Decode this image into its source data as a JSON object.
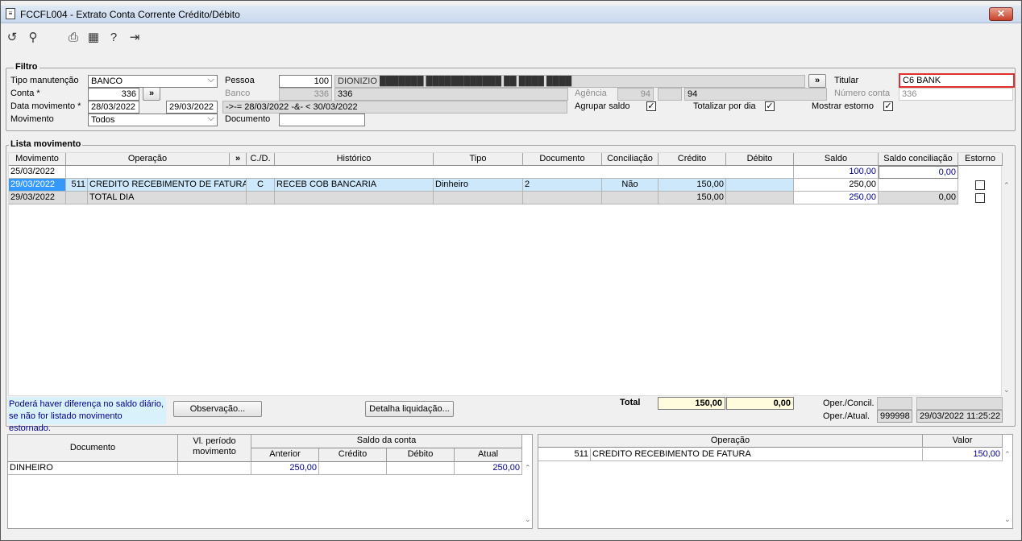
{
  "window": {
    "title": "FCCFL004 - Extrato Conta Corrente Crédito/Débito",
    "close": "✕"
  },
  "toolbar": {
    "icons": [
      "undo-icon",
      "search-icon",
      "print-icon",
      "calendar-icon",
      "help-icon",
      "exit-icon"
    ]
  },
  "filtro": {
    "legend": "Filtro",
    "tipo_manutencao_label": "Tipo manutenção",
    "tipo_manutencao_value": "BANCO",
    "conta_label": "Conta *",
    "conta_value": "336",
    "data_movimento_label": "Data movimento *",
    "data_inicio": "28/03/2022",
    "data_fim": "29/03/2022",
    "data_expr": "->-= 28/03/2022 -&- < 30/03/2022",
    "movimento_label": "Movimento",
    "movimento_value": "Todos",
    "pessoa_label": "Pessoa",
    "pessoa_code": "100",
    "pessoa_name": "DIONIZIO ███████ ████████████ ██ ████ ████",
    "banco_label": "Banco",
    "banco_value": "336",
    "banco_name": "336",
    "agencia_label": "Agência",
    "agencia_value": "94",
    "agencia_name": "94",
    "documento_label": "Documento",
    "documento_value": "",
    "titular_label": "Titular",
    "titular_value": "C6 BANK",
    "numero_conta_label": "Número conta",
    "numero_conta_value": "336",
    "agrupar_saldo_label": "Agrupar saldo",
    "totalizar_label": "Totalizar por dia",
    "mostrar_estorno_label": "Mostrar estorno",
    "more": "»",
    "check": "✓"
  },
  "lista": {
    "legend": "Lista movimento",
    "columns": [
      "Movimento",
      "Operação",
      "»",
      "C./D.",
      "Histórico",
      "Tipo",
      "Documento",
      "Conciliação",
      "Crédito",
      "Débito",
      "Saldo",
      "Saldo conciliação",
      "Estorno"
    ],
    "row0": {
      "movimento": "25/03/2022",
      "saldo": "100,00",
      "saldo_conc": "0,00"
    },
    "row1": {
      "movimento": "29/03/2022",
      "op_code": "511",
      "operacao": "CREDITO RECEBIMENTO DE FATURA",
      "cd": "C",
      "historico": "RECEB  COB  BANCARIA",
      "tipo": "Dinheiro",
      "documento": "2",
      "conciliacao": "Não",
      "credito": "150,00",
      "debito": "",
      "saldo": "250,00",
      "saldo_conc": ""
    },
    "row2": {
      "movimento": "29/03/2022",
      "operacao": "TOTAL DIA",
      "credito": "150,00",
      "saldo": "250,00",
      "saldo_conc": "0,00"
    }
  },
  "footer": {
    "note_line1": "Poderá haver diferença no saldo diário,",
    "note_line2": "se não for listado movimento estornado.",
    "observacao_btn": "Observação...",
    "detalha_btn": "Detalha liquidação...",
    "total_label": "Total",
    "total_credito": "150,00",
    "total_debito": "0,00",
    "oper_concil_label": "Oper./Concil.",
    "oper_atual_label": "Oper./Atual.",
    "oper_atual_code": "999998",
    "oper_atual_date": "29/03/2022 11:25:22"
  },
  "bottom_left": {
    "col_documento": "Documento",
    "col_vl_periodo": "Vl. período movimento",
    "col_saldo": "Saldo da conta",
    "col_anterior": "Anterior",
    "col_credito": "Crédito",
    "col_debito": "Débito",
    "col_atual": "Atual",
    "row": {
      "documento": "DINHEIRO",
      "anterior": "250,00",
      "atual": "250,00"
    }
  },
  "bottom_right": {
    "col_operacao": "Operação",
    "col_valor": "Valor",
    "row": {
      "code": "511",
      "operacao": "CREDITO RECEBIMENTO DE FATURA",
      "valor": "150,00"
    }
  },
  "colors": {
    "selection": "#cde8fb",
    "highlight": "#fffbdc",
    "titular_border": "#e03030",
    "note_bg": "#d9f1fb"
  }
}
